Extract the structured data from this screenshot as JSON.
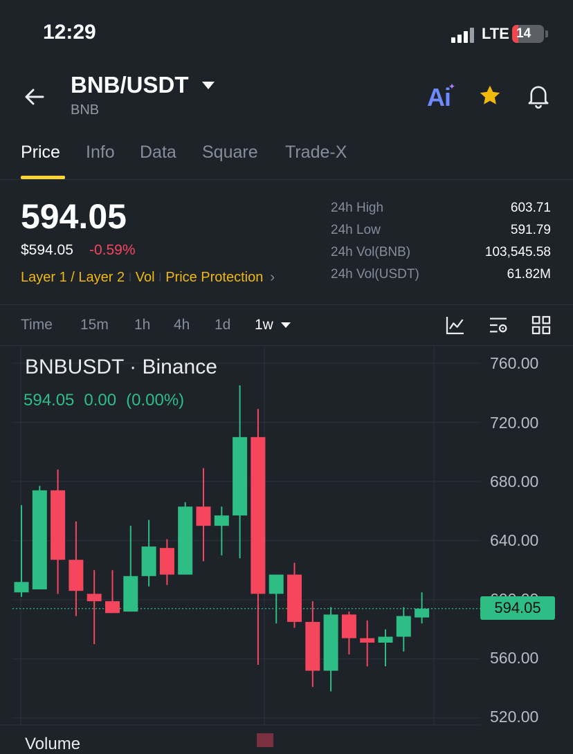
{
  "status_bar": {
    "time": "12:29",
    "network": "LTE",
    "battery": "14"
  },
  "header": {
    "pair": "BNB/USDT",
    "base": "BNB",
    "ai_label": "Ai"
  },
  "tabs": [
    {
      "label": "Price",
      "active": true
    },
    {
      "label": "Info"
    },
    {
      "label": "Data"
    },
    {
      "label": "Square"
    },
    {
      "label": "Trade-X"
    }
  ],
  "price": {
    "last": "594.05",
    "usd": "$594.05",
    "change": "-0.59%",
    "tags": [
      "Layer 1 / Layer 2",
      "Vol",
      "Price Protection"
    ]
  },
  "stats": [
    {
      "label": "24h High",
      "value": "603.71"
    },
    {
      "label": "24h Low",
      "value": "591.79"
    },
    {
      "label": "24h Vol(BNB)",
      "value": "103,545.58"
    },
    {
      "label": "24h Vol(USDT)",
      "value": "61.82M"
    }
  ],
  "intervals": [
    {
      "label": "Time"
    },
    {
      "label": "15m"
    },
    {
      "label": "1h"
    },
    {
      "label": "4h"
    },
    {
      "label": "1d"
    },
    {
      "label": "1w",
      "active": true
    }
  ],
  "chart": {
    "title": "BNBUSDT · Binance",
    "ohlc_price": "594.05",
    "ohlc_change": "0.00",
    "ohlc_pct": "(0.00%)",
    "current_price_tag": "594.05",
    "volume_label": "Volume",
    "y_axis_labels": [
      "760.00",
      "720.00",
      "680.00",
      "640.00",
      "600.00",
      "560.00",
      "520.00"
    ],
    "colors": {
      "up": "#2ebd85",
      "down": "#f6465d",
      "background": "#1e2329"
    }
  },
  "chart_data": {
    "type": "candlestick",
    "title": "BNBUSDT · Binance",
    "ylim": [
      515,
      765
    ],
    "y_ticks": [
      760,
      720,
      680,
      640,
      600,
      560,
      520
    ],
    "candles": [
      {
        "open": 605,
        "high": 664,
        "low": 602,
        "close": 612
      },
      {
        "open": 607,
        "high": 677,
        "low": 607,
        "close": 674
      },
      {
        "open": 674,
        "high": 688,
        "low": 604,
        "close": 627
      },
      {
        "open": 627,
        "high": 653,
        "low": 589,
        "close": 606
      },
      {
        "open": 604,
        "high": 620,
        "low": 570,
        "close": 599
      },
      {
        "open": 599,
        "high": 620,
        "low": 591,
        "close": 591
      },
      {
        "open": 592,
        "high": 650,
        "low": 592,
        "close": 616
      },
      {
        "open": 616,
        "high": 654,
        "low": 609,
        "close": 636
      },
      {
        "open": 635,
        "high": 641,
        "low": 610,
        "close": 617
      },
      {
        "open": 617,
        "high": 666,
        "low": 617,
        "close": 663
      },
      {
        "open": 663,
        "high": 689,
        "low": 626,
        "close": 650
      },
      {
        "open": 650,
        "high": 663,
        "low": 630,
        "close": 657
      },
      {
        "open": 657,
        "high": 745,
        "low": 628,
        "close": 710
      },
      {
        "open": 710,
        "high": 729,
        "low": 556,
        "close": 604
      },
      {
        "open": 604,
        "high": 617,
        "low": 584,
        "close": 617
      },
      {
        "open": 617,
        "high": 625,
        "low": 581,
        "close": 585
      },
      {
        "open": 585,
        "high": 599,
        "low": 541,
        "close": 552
      },
      {
        "open": 552,
        "high": 595,
        "low": 538,
        "close": 590
      },
      {
        "open": 590,
        "high": 592,
        "low": 563,
        "close": 574
      },
      {
        "open": 574,
        "high": 586,
        "low": 555,
        "close": 571
      },
      {
        "open": 571,
        "high": 580,
        "low": 555,
        "close": 575
      },
      {
        "open": 575,
        "high": 595,
        "low": 565,
        "close": 589
      },
      {
        "open": 588,
        "high": 605,
        "low": 584,
        "close": 594
      }
    ],
    "last_price": 594.05
  }
}
